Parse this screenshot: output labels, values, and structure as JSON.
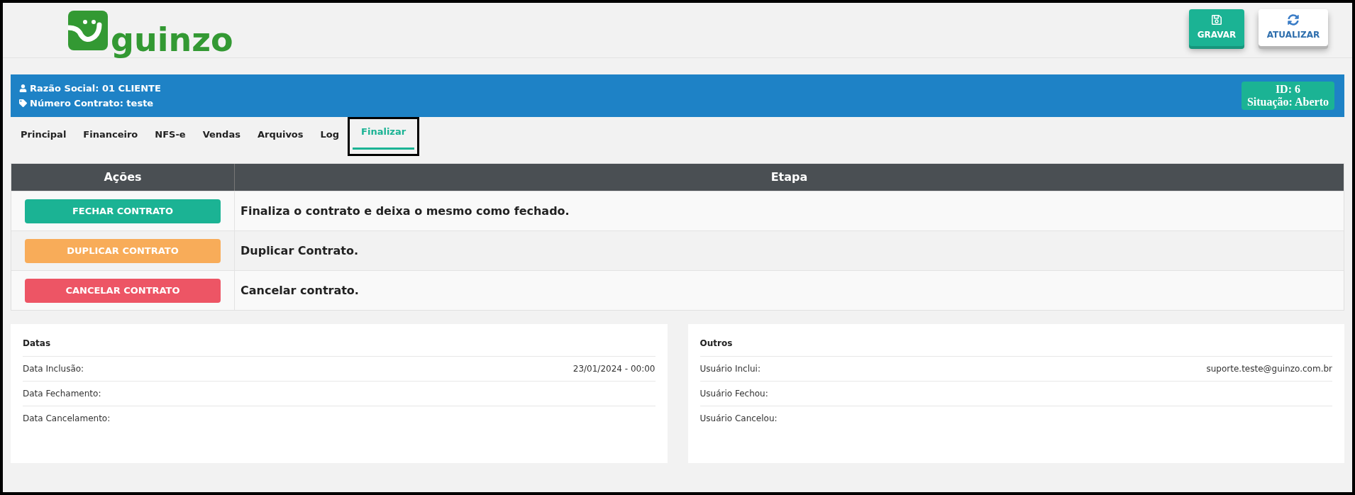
{
  "logo": {
    "text": "guinzo"
  },
  "toolbar": [
    {
      "kind": "save",
      "label": "GRAVAR"
    },
    {
      "kind": "refresh",
      "label": "ATUALIZAR"
    }
  ],
  "contract_bar": {
    "razao_social": "Razão Social: 01 CLIENTE",
    "numero_contrato": "Número Contrato: teste",
    "id": "ID: 6",
    "situacao": "Situação: Aberto"
  },
  "tabs": [
    {
      "label": "Principal",
      "selected": false
    },
    {
      "label": "Financeiro",
      "selected": false
    },
    {
      "label": "NFS-e",
      "selected": false
    },
    {
      "label": "Vendas",
      "selected": false
    },
    {
      "label": "Arquivos",
      "selected": false
    },
    {
      "label": "Log",
      "selected": false
    },
    {
      "label": "Finalizar",
      "selected": true
    }
  ],
  "table": {
    "columns": [
      "Ações",
      "Etapa"
    ],
    "rows": [
      {
        "kind": "success",
        "action": "FECHAR CONTRATO",
        "etapa": "Finaliza o contrato e deixa o mesmo como fechado."
      },
      {
        "kind": "warning",
        "action": "DUPLICAR CONTRATO",
        "etapa": "Duplicar Contrato."
      },
      {
        "kind": "danger",
        "action": "CANCELAR CONTRATO",
        "etapa": "Cancelar contrato."
      }
    ]
  },
  "cards": [
    {
      "title": "Datas",
      "rows": [
        {
          "label": "Data Inclusão:",
          "value": "23/01/2024 - 00:00"
        },
        {
          "label": "Data Fechamento:"
        },
        {
          "label": "Data Cancelamento:"
        }
      ]
    },
    {
      "title": "Outros",
      "rows": [
        {
          "label": "Usuário Inclui:",
          "value": "suporte.teste@guinzo.com.br"
        },
        {
          "label": "Usuário Fechou:"
        },
        {
          "label": "Usuário Cancelou:"
        }
      ]
    }
  ]
}
